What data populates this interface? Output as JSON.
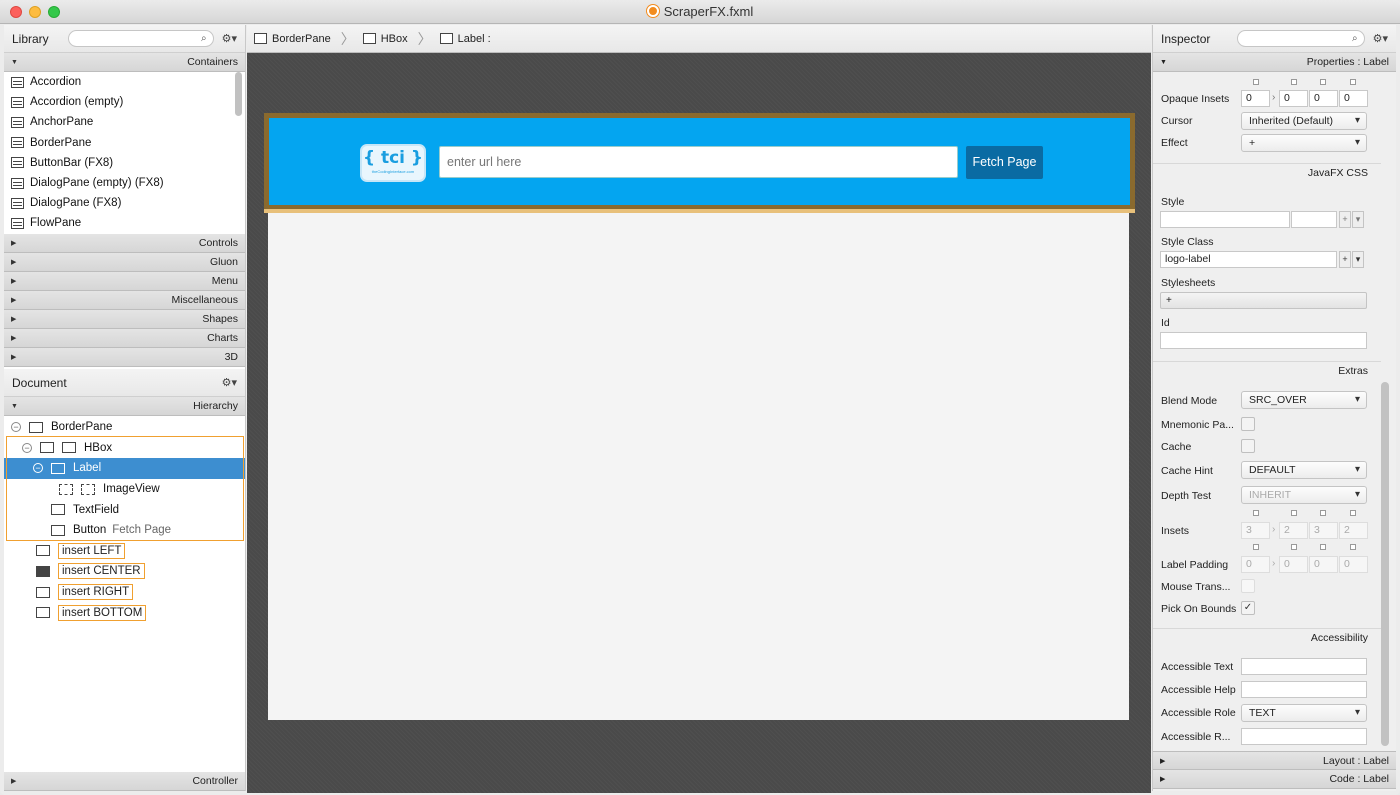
{
  "window": {
    "title": "ScraperFX.fxml"
  },
  "library": {
    "title": "Library",
    "containers_label": "Containers",
    "items": [
      "Accordion",
      "Accordion  (empty)",
      "AnchorPane",
      "BorderPane",
      "ButtonBar  (FX8)",
      "DialogPane (empty)  (FX8)",
      "DialogPane  (FX8)",
      "FlowPane"
    ],
    "sections": [
      "Controls",
      "Gluon",
      "Menu",
      "Miscellaneous",
      "Shapes",
      "Charts",
      "3D"
    ]
  },
  "document": {
    "title": "Document",
    "hierarchy_label": "Hierarchy",
    "tree": {
      "borderpane": "BorderPane",
      "hbox": "HBox",
      "label": "Label",
      "imageview": "ImageView",
      "textfield": "TextField",
      "button": "Button",
      "button_hint": "Fetch Page"
    },
    "inserts": [
      "insert LEFT",
      "insert CENTER",
      "insert RIGHT",
      "insert BOTTOM"
    ],
    "controller_label": "Controller"
  },
  "breadcrumb": [
    "BorderPane",
    "HBox",
    "Label :"
  ],
  "preview": {
    "logo_text": "{ tci }",
    "logo_sub": "theCodingInterface.com",
    "url_placeholder": "enter url here",
    "fetch_button": "Fetch Page"
  },
  "inspector": {
    "title": "Inspector",
    "properties_label": "Properties : Label",
    "opaque_insets_label": "Opaque Insets",
    "opaque_insets": [
      "0",
      "0",
      "0",
      "0"
    ],
    "cursor_label": "Cursor",
    "cursor_value": "Inherited (Default)",
    "effect_label": "Effect",
    "effect_value": "+",
    "javafx_css_label": "JavaFX CSS",
    "style_label": "Style",
    "style_class_label": "Style Class",
    "style_class_value": "logo-label",
    "stylesheets_label": "Stylesheets",
    "stylesheets_add": "+",
    "id_label": "Id",
    "extras_label": "Extras",
    "blend_mode_label": "Blend Mode",
    "blend_mode_value": "SRC_OVER",
    "mnemonic_label": "Mnemonic Pa...",
    "cache_label": "Cache",
    "cache_hint_label": "Cache Hint",
    "cache_hint_value": "DEFAULT",
    "depth_test_label": "Depth Test",
    "depth_test_value": "INHERIT",
    "insets_label": "Insets",
    "insets": [
      "3",
      "2",
      "3",
      "2"
    ],
    "label_padding_label": "Label Padding",
    "label_padding": [
      "0",
      "0",
      "0",
      "0"
    ],
    "mouse_trans_label": "Mouse Trans...",
    "pick_on_bounds_label": "Pick On Bounds",
    "pick_on_bounds_check": "✓",
    "accessibility_label": "Accessibility",
    "accessible_text_label": "Accessible Text",
    "accessible_help_label": "Accessible Help",
    "accessible_role_label": "Accessible Role",
    "accessible_role_value": "TEXT",
    "accessible_r_label": "Accessible R...",
    "layout_label": "Layout : Label",
    "code_label": "Code : Label"
  }
}
